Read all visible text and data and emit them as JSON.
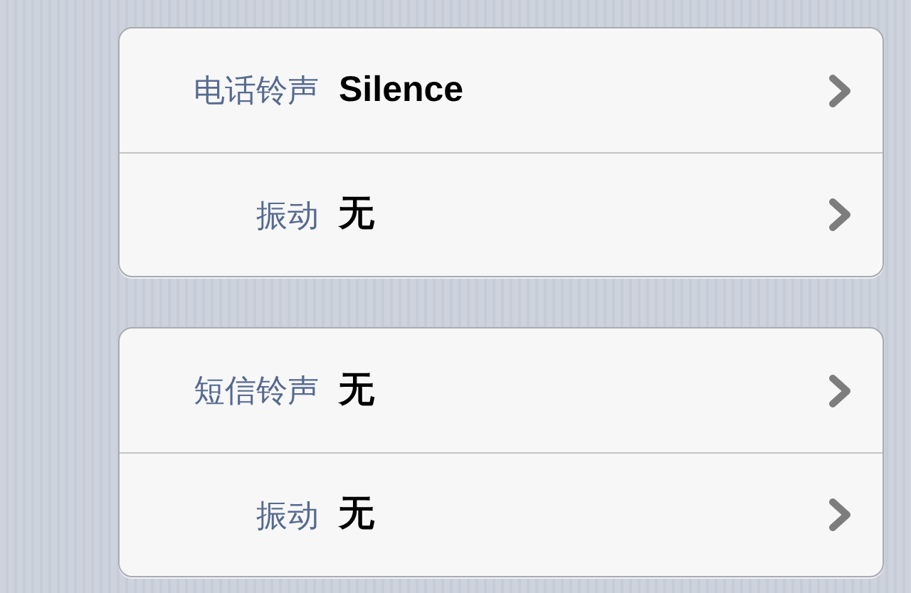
{
  "groups": [
    {
      "rows": [
        {
          "label": "电话铃声",
          "value": "Silence"
        },
        {
          "label": "振动",
          "value": "无"
        }
      ]
    },
    {
      "rows": [
        {
          "label": "短信铃声",
          "value": "无"
        },
        {
          "label": "振动",
          "value": "无"
        }
      ]
    }
  ]
}
